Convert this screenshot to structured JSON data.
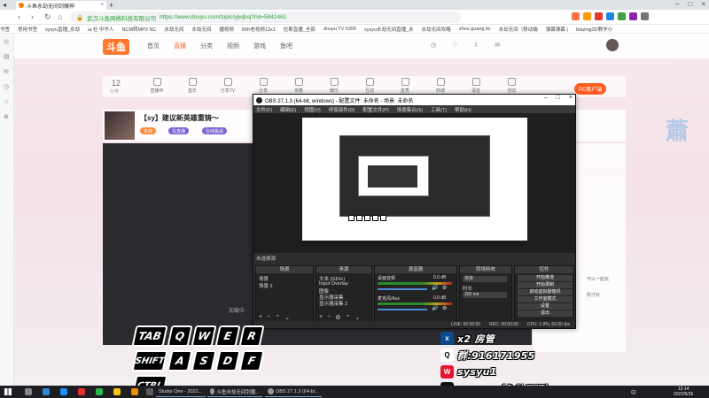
{
  "browser": {
    "tab_title": "斗鱼永劫无间剑魔神",
    "url_secure_label": "安全",
    "url_site_label": "武汉斗鱼网络科技有限公司",
    "url": "https://www.douyu.com/topic/yjwjbsj?rid=5842461",
    "bookmarks": [
      "书签",
      "常用书签",
      "sysyu直播_永劫",
      "ia 社 中华人",
      "NCM转MP3 NC",
      "永劫无间",
      "永劫无间",
      "播视频",
      "60fr老视频13x1",
      "拉斯直播_全部",
      "douyu TV 5306",
      "sysyu永劫无间直播_永",
      "永劫无间攻略",
      "zhou guang bc",
      "永劫无间（移动端",
      "弹幕弹幕 (",
      "blazing2D教学小"
    ]
  },
  "douyu": {
    "nav": [
      "首页",
      "直播",
      "分类",
      "视频",
      "游戏",
      "鱼吧"
    ],
    "category_count": "12",
    "category_sub": "分类",
    "categories": [
      "直播中",
      "音乐",
      "分享TV",
      "分享",
      "攻略",
      "娱乐",
      "互动",
      "星秀",
      "商城",
      "语音",
      "活动"
    ],
    "pc_button": "PC客户端",
    "room_title": "【sy】建议新英雄重铸～",
    "room_tags": [
      "永劫",
      "在直播",
      "在线挑战"
    ],
    "chat_lines": [
      "可以一起玩",
      "刚才好"
    ],
    "video_ghost_text": "加载中"
  },
  "obs": {
    "title": "OBS 27.1.3 (64-bit, windows) - 配置文件: 未命名 - 场景: 未命名",
    "menu": [
      "文件(F)",
      "编辑(E)",
      "视图(V)",
      "停靠部件(D)",
      "配置文件(P)",
      "场景集合(S)",
      "工具(T)",
      "帮助(H)"
    ],
    "no_source_label": "未选择源",
    "scenes_header": "场景",
    "scenes": [
      "场景",
      "场景 2"
    ],
    "sources_header": "来源",
    "sources": [
      "文本 (GDI+)",
      "Input Overlay",
      "图像",
      "显示器采集",
      "显示器采集 2"
    ],
    "mixer_header": "混音器",
    "mixer_channels": [
      {
        "name": "桌面音频",
        "db": "0.0 dB"
      },
      {
        "name": "麦克风/Aux",
        "db": "0.0 dB"
      }
    ],
    "transitions_header": "转场特效",
    "transition_value": "渐变",
    "duration_label": "时长",
    "duration_value": "300 ms",
    "controls_header": "控件",
    "controls": [
      "开始推流",
      "开始录制",
      "启动虚拟摄像机",
      "工作室模式",
      "设置",
      "退出"
    ],
    "status_bar": [
      "LIVE: 00:00:00",
      "REC: 00:00:00",
      "CPU: 1.9%, 60.00 fps"
    ]
  },
  "keys": {
    "row1": [
      "TAB",
      "Q",
      "W",
      "E",
      "R"
    ],
    "row2": [
      "SHIFT",
      "A",
      "S",
      "D",
      "F"
    ],
    "row3": [
      "CTRL"
    ]
  },
  "overlay_info": [
    {
      "icon": "x",
      "text": "x2  房管"
    },
    {
      "icon": "Q",
      "text": "群:916171955"
    },
    {
      "icon": "W",
      "text": "sysyu1"
    },
    {
      "icon": "D",
      "text": "sysyu （永劫无间）"
    }
  ],
  "taskbar": {
    "apps": [
      "Studio One - 2022...",
      "斗鱼永劫无间剑魔...",
      "OBS 27.1.3 (64-bi..."
    ],
    "tray_lang": "中",
    "clock_time": "12:14",
    "clock_date": "2022/5/26"
  },
  "colors": {
    "accent_orange": "#ff5d23",
    "obs_bg": "#2b2b2b",
    "taskbar": "#1e1e23"
  }
}
